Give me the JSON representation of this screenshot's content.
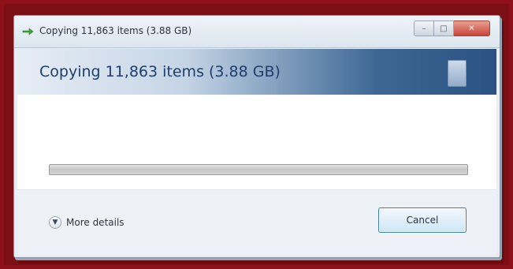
{
  "window": {
    "title": "Copying 11,863 items (3.88 GB)"
  },
  "dialog": {
    "heading": "Copying 11,863 items (3.88 GB)",
    "progress_fraction": 0.0
  },
  "footer": {
    "details_label": "More details",
    "cancel_label": "Cancel"
  },
  "icons": {
    "title": "copy-arrow-icon",
    "details": "chevron-down-icon",
    "animation": "file-copy-animation-icon"
  },
  "colors": {
    "outer_background": "#7a0f16",
    "header_accent": "#2b5282",
    "button_border": "#3c7fb1"
  }
}
